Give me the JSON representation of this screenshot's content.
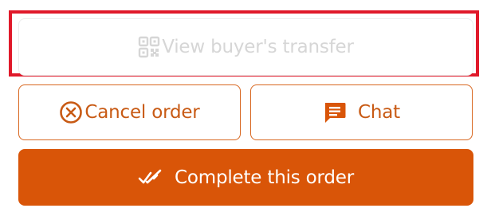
{
  "actions": {
    "view_transfer_label": "View buyer's transfer",
    "cancel_label": "Cancel order",
    "chat_label": "Chat",
    "complete_label": "Complete this order"
  },
  "icons": {
    "view_transfer": "qr-code-icon",
    "cancel": "cancel-circle-icon",
    "chat": "chat-bubble-icon",
    "complete": "double-check-icon"
  },
  "colors": {
    "accent": "#d95508",
    "accent_text": "#c85a14",
    "disabled_text": "#d6d6d6",
    "highlight": "#e0192a"
  }
}
